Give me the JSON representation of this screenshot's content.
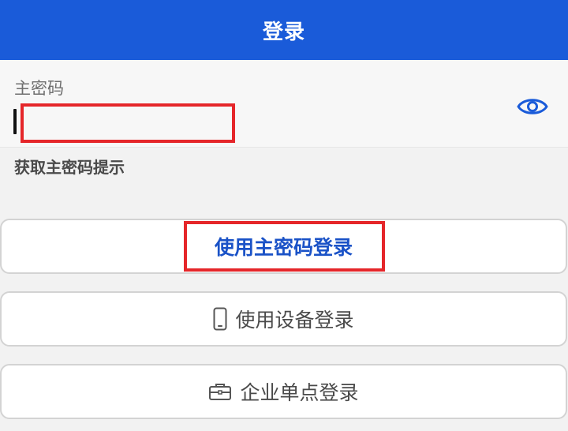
{
  "header": {
    "title": "登录"
  },
  "master_password": {
    "label": "主密码",
    "value": "",
    "visibility_icon": "eye-icon"
  },
  "hint_link": "获取主密码提示",
  "buttons": {
    "master_password_login": "使用主密码登录",
    "device_login": "使用设备登录",
    "device_icon": "phone-icon",
    "sso_login": "企业单点登录",
    "sso_icon": "briefcase-icon"
  },
  "colors": {
    "header_bg": "#1a5bd9",
    "primary_text": "#1a52c7",
    "highlight": "#e5262a",
    "icon": "#1a5bd9"
  }
}
